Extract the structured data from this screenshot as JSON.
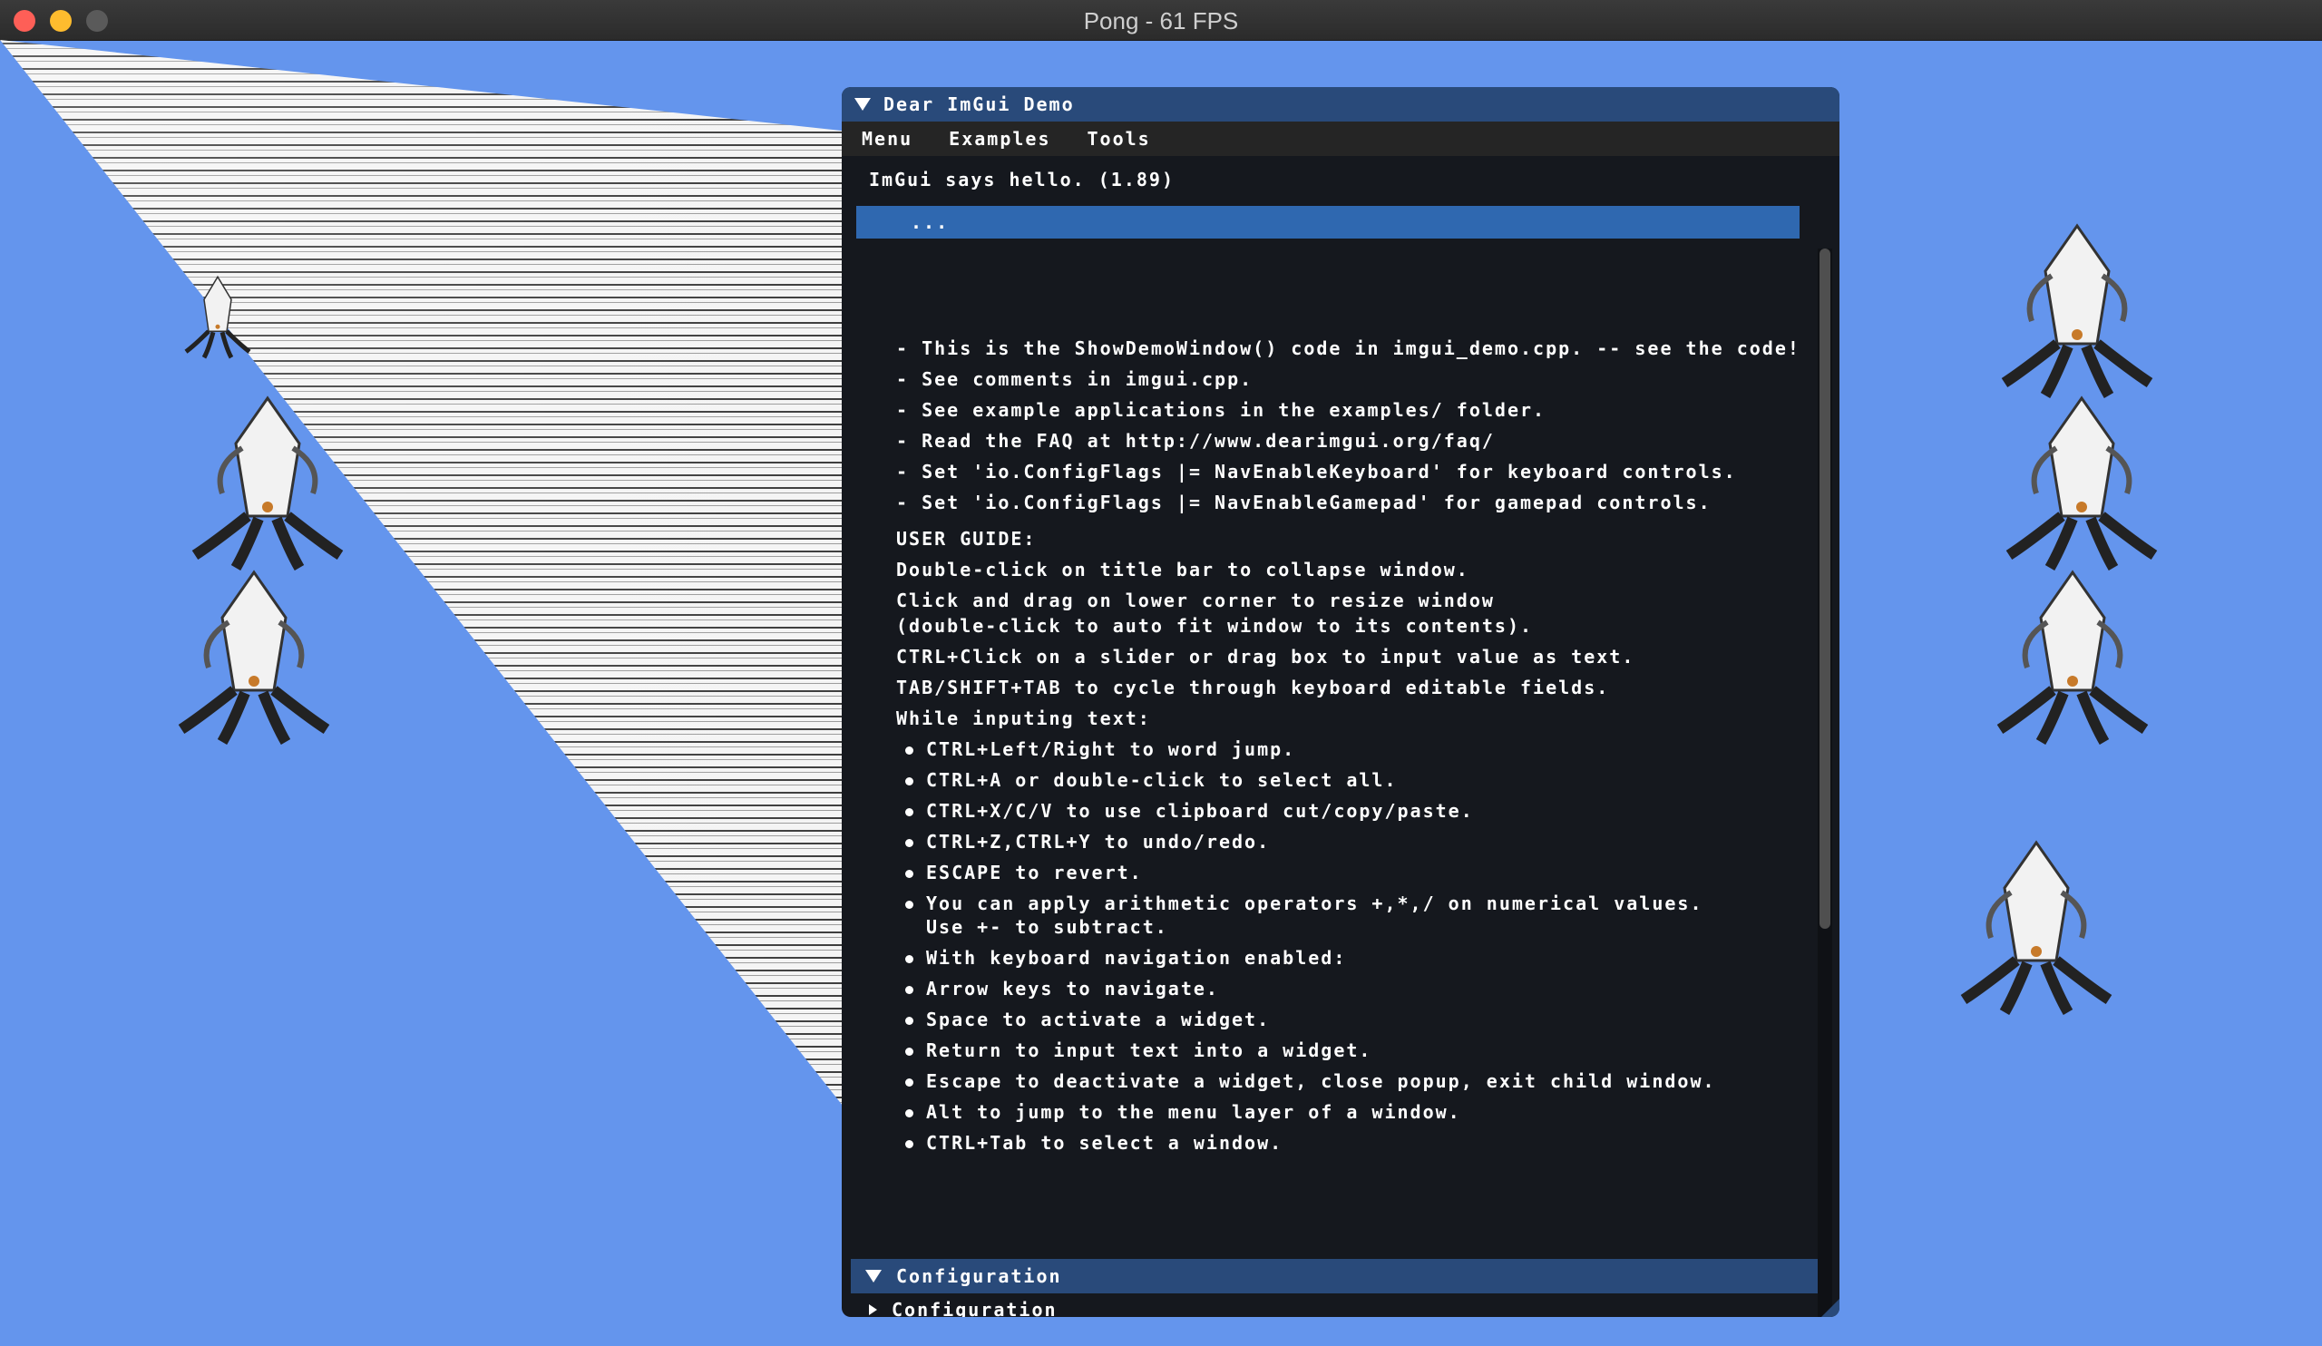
{
  "window": {
    "title": "Pong - 61 FPS"
  },
  "colors": {
    "background": "#6495ed",
    "imgui_title": "#294a7a",
    "imgui_bg": "#15181e",
    "selected_row": "#2f68b0"
  },
  "imgui": {
    "title": "Dear ImGui Demo",
    "menu": [
      "Menu",
      "Examples",
      "Tools"
    ],
    "fps_line": "ImGui says hello. (1.89)",
    "input_text": "...",
    "help_lines": [
      "- This is the ShowDemoWindow() code in imgui_demo.cpp. -- see the code!",
      "- See comments in imgui.cpp.",
      "- See example applications in the examples/ folder.",
      "- Read the FAQ at http://www.dearimgui.org/faq/",
      "- Set 'io.ConfigFlags |= NavEnableKeyboard' for keyboard controls.",
      "- Set 'io.ConfigFlags |= NavEnableGamepad' for gamepad controls.",
      "USER GUIDE:",
      "Double-click on title bar to collapse window.",
      "Click and drag on lower corner to resize window",
      "(double-click to auto fit window to its contents).",
      "CTRL+Click on a slider or drag box to input value as text.",
      "TAB/SHIFT+TAB to cycle through keyboard editable fields.",
      "While inputing text:"
    ],
    "bullets": [
      "CTRL+Left/Right to word jump.",
      "CTRL+A or double-click to select all.",
      "CTRL+X/C/V to use clipboard cut/copy/paste.",
      "CTRL+Z,CTRL+Y to undo/redo.",
      "ESCAPE to revert.",
      "You can apply arithmetic operators +,*,/ on numerical values.",
      "Use +- to subtract.",
      "With keyboard navigation enabled:",
      "Arrow keys to navigate.",
      "Space to activate a widget.",
      "Return to input text into a widget.",
      "Escape to deactivate a widget, close popup, exit child window.",
      "Alt to jump to the menu layer of a window.",
      "CTRL+Tab to select a window."
    ],
    "section_header": "Configuration",
    "tree_node": "Configuration"
  }
}
